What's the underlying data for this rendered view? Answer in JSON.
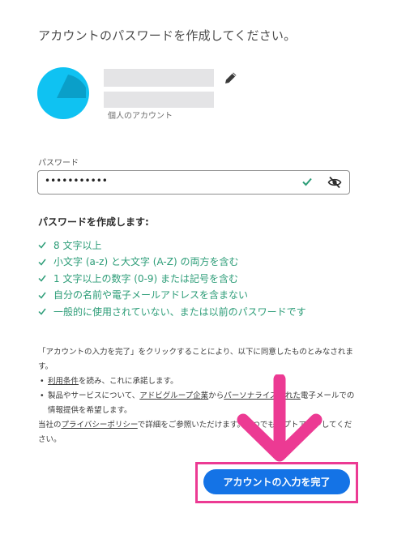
{
  "page": {
    "title": "アカウントのパスワードを作成してください。"
  },
  "account": {
    "avatar_colors": [
      "#0fc2f2",
      "#0a9fc9"
    ],
    "name": "",
    "email": "",
    "type_label": "個人のアカウント",
    "edit_icon": "pencil-icon"
  },
  "password": {
    "label": "パスワード",
    "masked_value": "•••••••••••",
    "valid_icon": "checkmark-icon",
    "visibility_icon": "eye-slash-icon"
  },
  "requirements": {
    "heading": "パスワードを作成します:",
    "color": "#2d9d78",
    "items": [
      "8 文字以上",
      "小文字 (a-z) と大文字 (A-Z) の両方を含む",
      "1 文字以上の数字 (0-9) または記号を含む",
      "自分の名前や電子メールアドレスを含まない",
      "一般的に使用されていない、または以前のパスワードです"
    ]
  },
  "legal": {
    "intro": "「アカウントの入力を完了」をクリックすることにより、以下に同意したものとみなされます。",
    "bullet1_link": "利用条件",
    "bullet1_text": "を読み、これに承諾します。",
    "bullet2_prefix": "製品やサービスについて、",
    "bullet2_link1": "アドビグループ企業",
    "bullet2_middle": "から",
    "bullet2_link2": "パーソナライズされた",
    "bullet2_suffix": "電子メールでの情報提供を希望します。",
    "privacy_prefix": "当社の",
    "privacy_link": "プライバシーポリシー",
    "privacy_suffix": "で詳細をご参照いただけます。いつでもオプトアウトしてください。"
  },
  "cta": {
    "label": "アカウントの入力を完了",
    "color": "#1473e6",
    "highlight_color": "#ec3a93",
    "arrow_icon": "arrow-down-icon"
  }
}
